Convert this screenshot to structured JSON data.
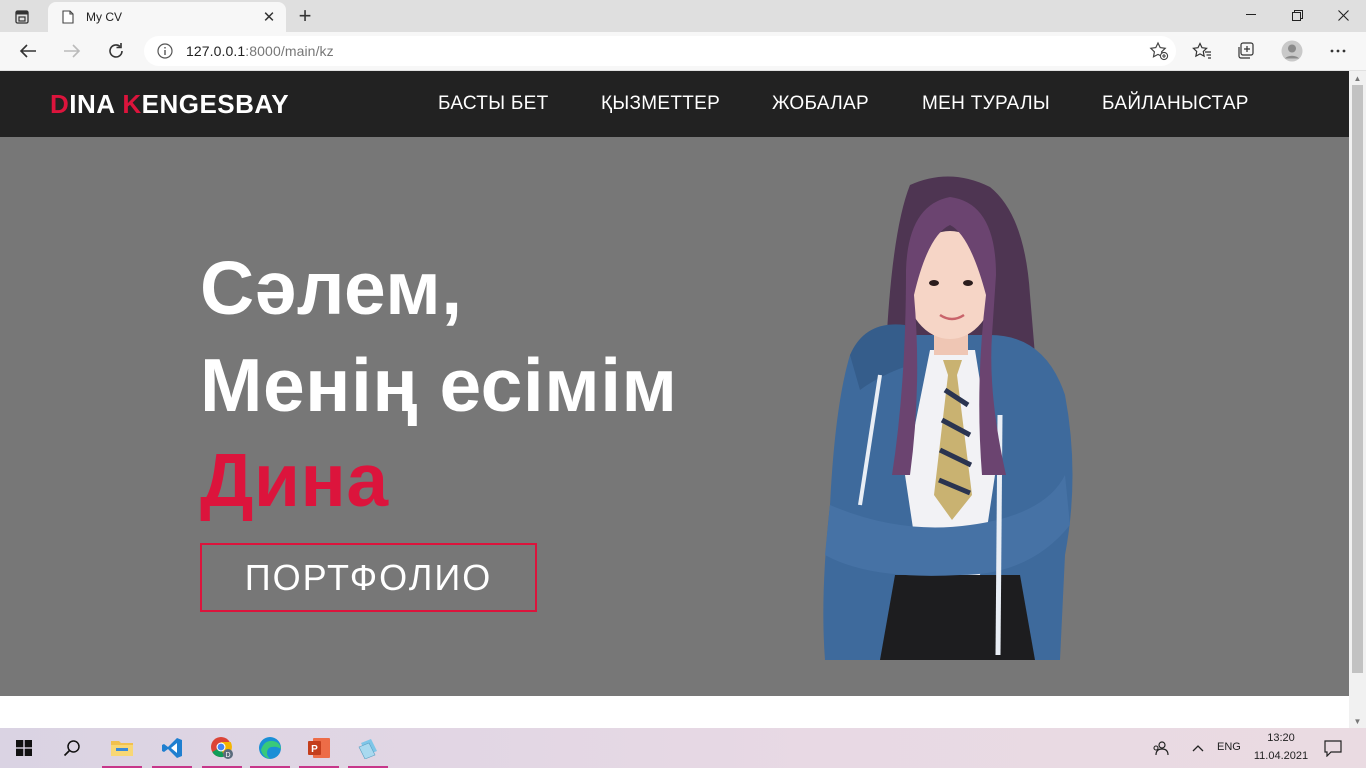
{
  "browser": {
    "tab_title": "My CV",
    "url_host": "127.0.0.1",
    "url_rest": ":8000/main/kz"
  },
  "site": {
    "logo": {
      "first_initial": "D",
      "first_rest": "INA ",
      "last_initial": "K",
      "last_rest": "ENGESBAY"
    },
    "nav": {
      "home": "БАСТЫ БЕТ",
      "services": "ҚЫЗМЕТТЕР",
      "projects": "ЖОБАЛАР",
      "about": "МЕН ТУРАЛЫ",
      "contacts": "БАЙЛАНЫСТАР"
    },
    "hero": {
      "greeting": "Сәлем,",
      "intro": "Менің есімім",
      "name": "Дина",
      "button": "ПОРТФОЛИО"
    },
    "colors": {
      "accent": "#dc143c",
      "header_bg": "#222222",
      "hero_bg": "#777777"
    }
  },
  "taskbar": {
    "language": "ENG",
    "time": "13:20",
    "date": "11.04.2021"
  }
}
